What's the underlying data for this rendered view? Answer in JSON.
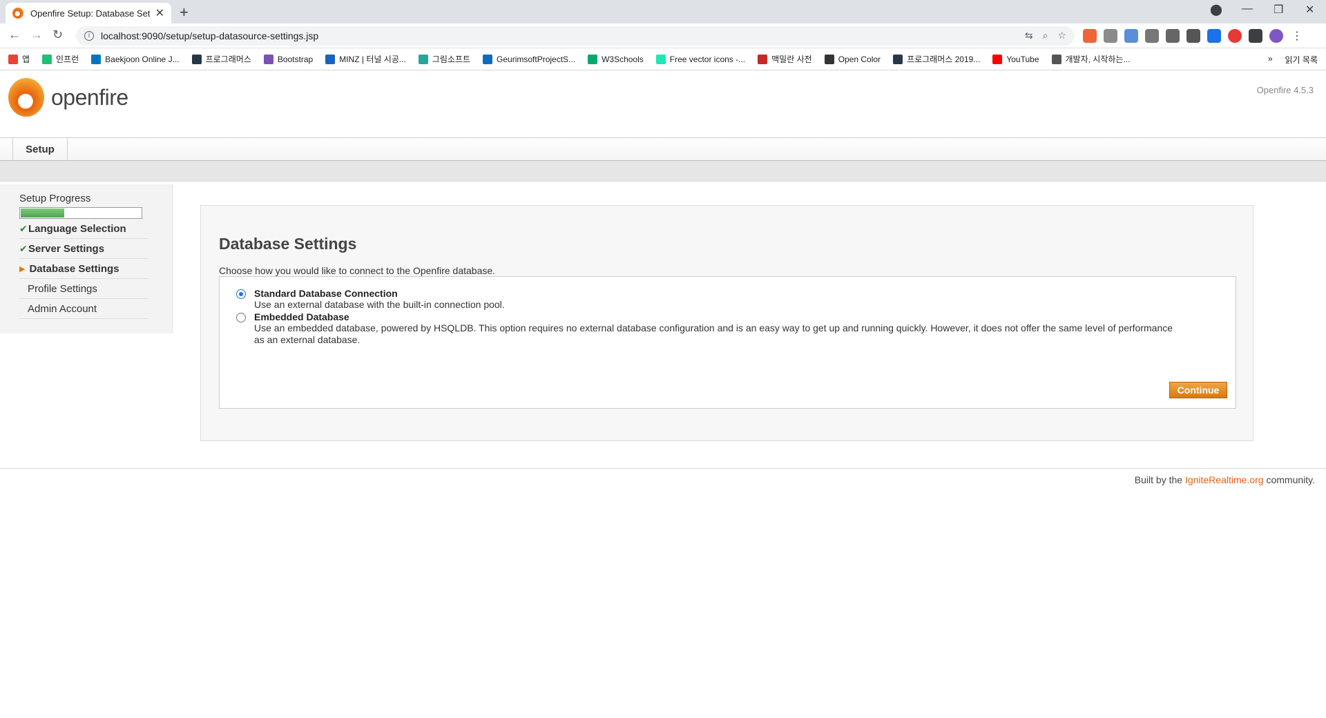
{
  "browser": {
    "tab_title": "Openfire Setup: Database Settin",
    "new_tab": "+",
    "url": "localhost:9090/setup/setup-datasource-settings.jsp",
    "bookmarks": [
      {
        "label": "앱",
        "color": "#ea4335"
      },
      {
        "label": "인프런",
        "color": "#1fbf75"
      },
      {
        "label": "Baekjoon Online J...",
        "color": "#0076c0"
      },
      {
        "label": "프로그래머스",
        "color": "#263747"
      },
      {
        "label": "Bootstrap",
        "color": "#7952b3"
      },
      {
        "label": "MINZ | 터널 시공...",
        "color": "#1565c0"
      },
      {
        "label": "그림소프트",
        "color": "#26a69a"
      },
      {
        "label": "GeurimsoftProjectS...",
        "color": "#0f6cbd"
      },
      {
        "label": "W3Schools",
        "color": "#04aa6d"
      },
      {
        "label": "Free vector icons -...",
        "color": "#1de9b6"
      },
      {
        "label": "맥밀란 사전",
        "color": "#c62828"
      },
      {
        "label": "Open Color",
        "color": "#333333"
      },
      {
        "label": "프로그래머스 2019...",
        "color": "#263747"
      },
      {
        "label": "YouTube",
        "color": "#ff0000"
      },
      {
        "label": "개발자, 시작하는...",
        "color": "#555555"
      }
    ],
    "more_bookmarks": "»",
    "reading_list": "읽기 목록"
  },
  "header": {
    "logo_text": "openfire",
    "version": "Openfire 4.5.3"
  },
  "nav": {
    "setup_tab": "Setup"
  },
  "sidebar": {
    "title": "Setup Progress",
    "progress": 0.36,
    "steps": [
      {
        "label": "Language Selection",
        "state": "done"
      },
      {
        "label": "Server Settings",
        "state": "done"
      },
      {
        "label": "Database Settings",
        "state": "current"
      },
      {
        "label": "Profile Settings",
        "state": "todo"
      },
      {
        "label": "Admin Account",
        "state": "todo"
      }
    ]
  },
  "main": {
    "title": "Database Settings",
    "description": "Choose how you would like to connect to the Openfire database.",
    "options": [
      {
        "title": "Standard Database Connection",
        "description": "Use an external database with the built-in connection pool.",
        "selected": true
      },
      {
        "title": "Embedded Database",
        "description": "Use an embedded database, powered by HSQLDB. This option requires no external database configuration and is an easy way to get up and running quickly. However, it does not offer the same level of performance as an external database.",
        "selected": false
      }
    ],
    "continue_label": "Continue"
  },
  "footer": {
    "prefix": "Built by the",
    "link": "IgniteRealtime.org",
    "suffix": "community."
  }
}
